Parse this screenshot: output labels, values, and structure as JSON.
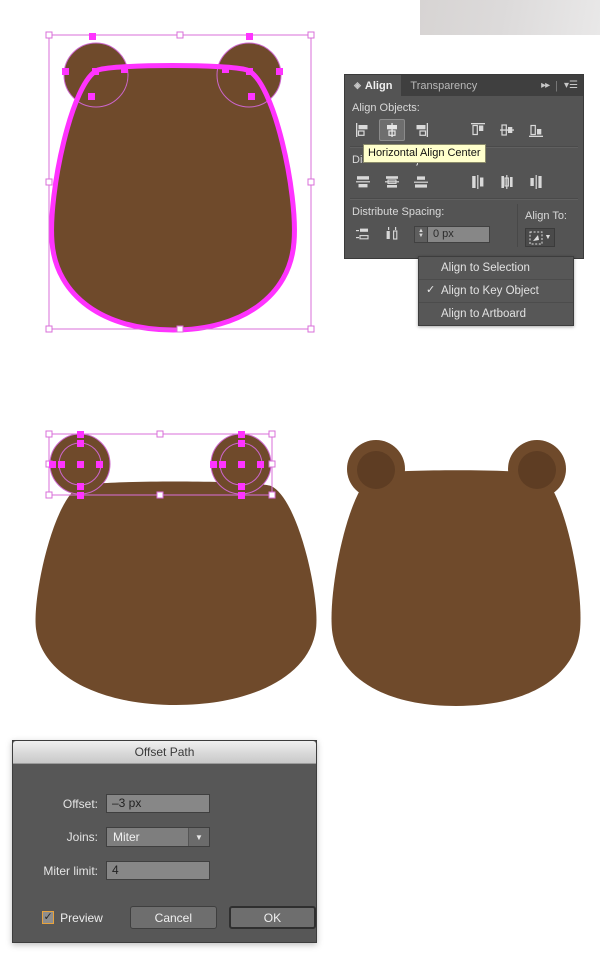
{
  "app": "Adobe Illustrator",
  "colors": {
    "bear_body": "#6f4a2b",
    "bear_inner_ear": "#5e3d23",
    "selection_magenta": "#ff33ff",
    "selection_outline": "#cc66cc",
    "tooltip_bg": "#ffffcc",
    "preview_check_border": "#e8a33d",
    "panel_bg": "#545454",
    "dialog_bg": "#575757"
  },
  "gray_swatch": {
    "name": "gray-gradient-swatch"
  },
  "align_panel": {
    "tabs": [
      {
        "label": "Align",
        "active": true
      },
      {
        "label": "Transparency",
        "active": false
      }
    ],
    "collapse_icon": "double-arrow-right-icon",
    "menu_icon": "panel-menu-icon",
    "align_objects": {
      "label": "Align Objects:",
      "buttons": [
        {
          "name": "horizontal-align-left",
          "selected": false
        },
        {
          "name": "horizontal-align-center",
          "selected": true
        },
        {
          "name": "horizontal-align-right",
          "selected": false
        },
        {
          "name": "vertical-align-top",
          "selected": false
        },
        {
          "name": "vertical-align-center",
          "selected": false
        },
        {
          "name": "vertical-align-bottom",
          "selected": false
        }
      ]
    },
    "distribute_objects": {
      "label": "Distribute Objects:",
      "buttons": [
        {
          "name": "vertical-distribute-top",
          "selected": false
        },
        {
          "name": "vertical-distribute-center",
          "selected": false
        },
        {
          "name": "vertical-distribute-bottom",
          "selected": false
        },
        {
          "name": "horizontal-distribute-left",
          "selected": false
        },
        {
          "name": "horizontal-distribute-center",
          "selected": false
        },
        {
          "name": "horizontal-distribute-right",
          "selected": false
        }
      ]
    },
    "distribute_spacing": {
      "label": "Distribute Spacing:",
      "buttons": [
        {
          "name": "vertical-distribute-space",
          "selected": false
        },
        {
          "name": "horizontal-distribute-space",
          "selected": false
        }
      ],
      "value": "0 px",
      "placeholder": "0 px"
    },
    "align_to": {
      "label": "Align To:",
      "button_icon": "align-to-key-object-icon",
      "dropdown_arrow": "chevron-down-icon"
    }
  },
  "tooltip": {
    "text": "Horizontal Align Center"
  },
  "align_dropdown": {
    "items": [
      {
        "label": "Align to Selection",
        "checked": false
      },
      {
        "label": "Align to Key Object",
        "checked": true
      },
      {
        "label": "Align to Artboard",
        "checked": false
      }
    ],
    "check_glyph": "✓"
  },
  "offset_dialog": {
    "title": "Offset Path",
    "fields": [
      {
        "label": "Offset:",
        "value": "–3 px",
        "type": "input"
      },
      {
        "label": "Joins:",
        "value": "Miter",
        "type": "select"
      },
      {
        "label": "Miter limit:",
        "value": "4",
        "type": "input"
      }
    ],
    "preview": {
      "label": "Preview",
      "checked": true,
      "glyph": "✓"
    },
    "cancel_label": "Cancel",
    "ok_label": "OK"
  },
  "canvas": {
    "bears": [
      {
        "name": "bear-head-selected-outline",
        "selected": true,
        "note": "magenta offset path preview with anchor points"
      },
      {
        "name": "bear-ears-selected",
        "selected": true,
        "note": "two ear circles selected with bounding box"
      },
      {
        "name": "bear-head-final",
        "selected": false,
        "note": "finished bear head with darker inner ears"
      }
    ]
  }
}
